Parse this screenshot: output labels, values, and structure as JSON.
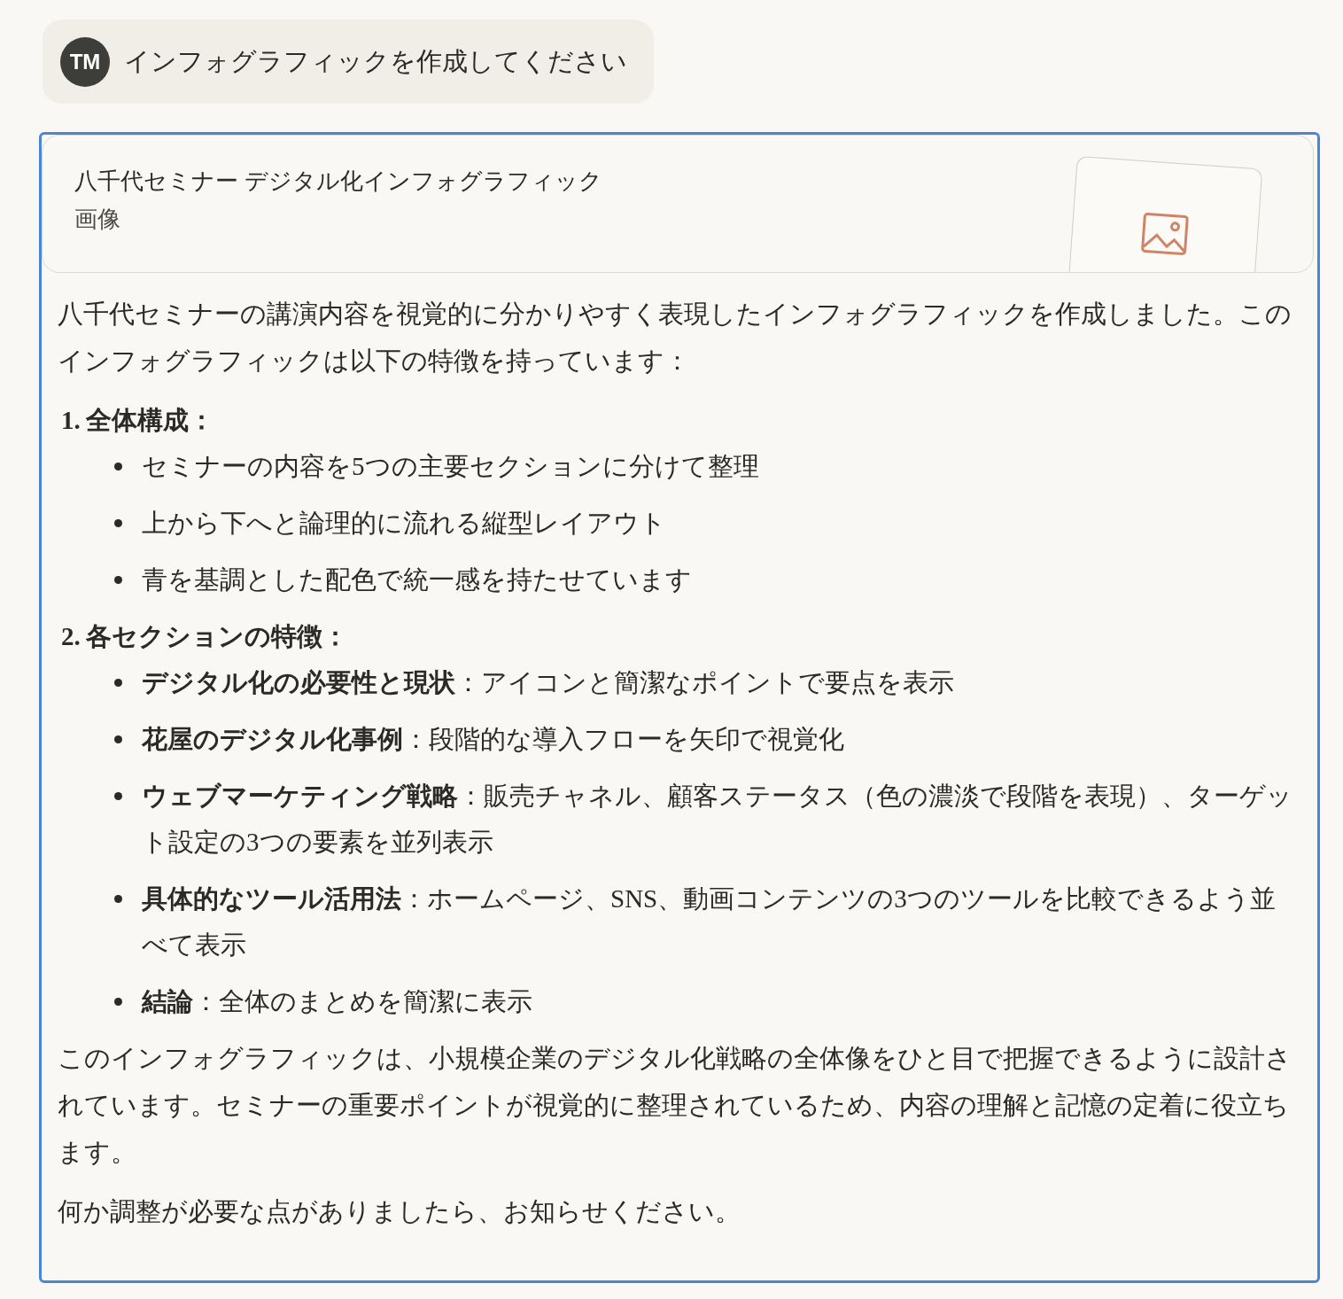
{
  "user_message": {
    "avatar": "TM",
    "text": "インフォグラフィックを作成してください"
  },
  "artifact": {
    "title": "八千代セミナー デジタル化インフォグラフィック",
    "type": "画像"
  },
  "response": {
    "intro": "八千代セミナーの講演内容を視覚的に分かりやすく表現したインフォグラフィックを作成しました。このインフォグラフィックは以下の特徴を持っています：",
    "sections": [
      {
        "number": "1.",
        "heading": "全体構成：",
        "items": [
          "セミナーの内容を5つの主要セクションに分けて整理",
          "上から下へと論理的に流れる縦型レイアウト",
          "青を基調とした配色で統一感を持たせています"
        ]
      },
      {
        "number": "2.",
        "heading": "各セクションの特徴：",
        "items": [
          "**デジタル化の必要性と現状**：アイコンと簡潔なポイントで要点を表示",
          "**花屋のデジタル化事例**：段階的な導入フローを矢印で視覚化",
          "**ウェブマーケティング戦略**：販売チャネル、顧客ステータス（色の濃淡で段階を表現）、ターゲット設定の3つの要素を並列表示",
          "**具体的なツール活用法**：ホームページ、SNS、動画コンテンツの3つのツールを比較できるよう並べて表示",
          "**結論**：全体のまとめを簡潔に表示"
        ]
      }
    ],
    "paragraphs": [
      "このインフォグラフィックは、小規模企業のデジタル化戦略の全体像をひと目で把握できるように設計されています。セミナーの重要ポイントが視覚的に整理されているため、内容の理解と記憶の定着に役立ちます。",
      "何か調整が必要な点がありましたら、お知らせください。"
    ]
  }
}
